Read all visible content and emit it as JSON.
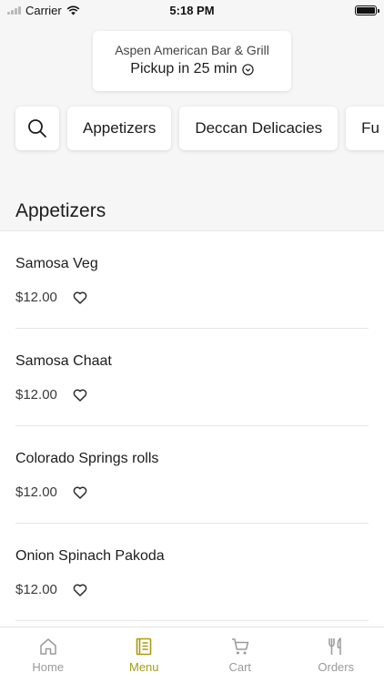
{
  "status_bar": {
    "carrier": "Carrier",
    "time": "5:18 PM"
  },
  "store": {
    "name": "Aspen American Bar & Grill",
    "pickup": "Pickup in 25 min"
  },
  "categories": [
    "Appetizers",
    "Deccan Delicacies",
    "Fu"
  ],
  "section": {
    "title": "Appetizers"
  },
  "items": [
    {
      "name": "Samosa Veg",
      "price": "$12.00"
    },
    {
      "name": "Samosa Chaat",
      "price": "$12.00"
    },
    {
      "name": "Colorado Springs rolls",
      "price": "$12.00"
    },
    {
      "name": "Onion Spinach Pakoda",
      "price": "$12.00"
    }
  ],
  "tabbar": {
    "home": "Home",
    "menu": "Menu",
    "cart": "Cart",
    "orders": "Orders"
  },
  "colors": {
    "accent": "#a99b14",
    "inactive": "#9a9a9a"
  }
}
